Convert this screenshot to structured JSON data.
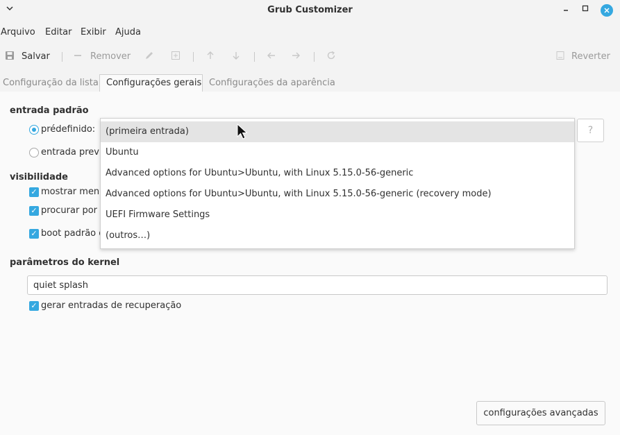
{
  "window": {
    "title": "Grub Customizer",
    "menu_icon": "chevron-down-icon",
    "minimize_icon": "minimize-icon",
    "maximize_icon": "maximize-icon",
    "close_icon": "close-icon"
  },
  "menubar": {
    "items": [
      "Arquivo",
      "Editar",
      "Exibir",
      "Ajuda"
    ]
  },
  "toolbar": {
    "save_label": "Salvar",
    "remove_label": "Remover",
    "revert_label": "Reverter"
  },
  "tabs": [
    {
      "label": "Configuração da lista",
      "active": false
    },
    {
      "label": "Configurações gerais",
      "active": true
    },
    {
      "label": "Configurações da aparência",
      "active": false
    }
  ],
  "default_entry": {
    "heading": "entrada padrão",
    "predefined_label": "prédefinido:",
    "previous_label": "entrada previa",
    "help_label": "?",
    "options": [
      "(primeira entrada)",
      "Ubuntu",
      "Advanced options for Ubuntu>Ubuntu, with Linux 5.15.0-56-generic",
      "Advanced options for Ubuntu>Ubuntu, with Linux 5.15.0-56-generic (recovery mode)",
      "UEFI Firmware Settings",
      "(outros…)"
    ],
    "selected_index": 0
  },
  "visibility": {
    "heading": "visibilidade",
    "show_menu_label": "mostrar menu",
    "search_label": "procurar por o",
    "boot_default_label": "boot padrão d"
  },
  "kernel": {
    "heading": "parâmetros do kernel",
    "value": "quiet splash",
    "recovery_label": "gerar entradas de recuperação"
  },
  "advanced_button_label": "configurações avançadas",
  "colors": {
    "accent": "#35a8e0",
    "background": "#fafafa",
    "window": "#f3f3f3"
  }
}
